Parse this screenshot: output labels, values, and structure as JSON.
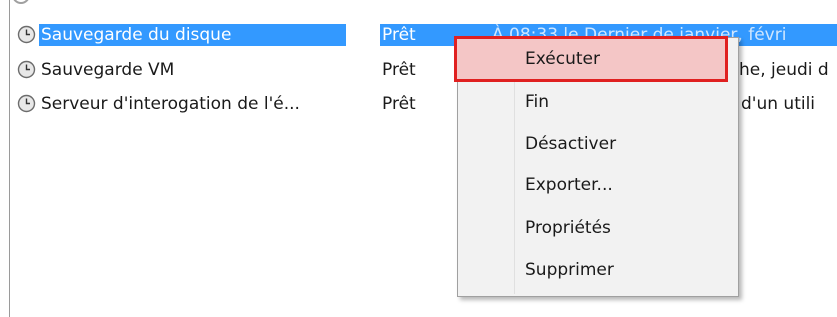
{
  "tasks": [
    {
      "name": "Sauvegarde du disque",
      "status": "Prêt",
      "trigger": "À 08:33 le Dernier de janvier, févri",
      "selected": true
    },
    {
      "name": "Sauvegarde VM",
      "status": "Prêt",
      "trigger": "he, jeudi d"
    },
    {
      "name": "Serveur d'interogation de l'é...",
      "status": "Prêt",
      "trigger": "d'un utili"
    }
  ],
  "context_menu": {
    "items": [
      "Exécuter",
      "Fin",
      "Désactiver",
      "Exporter...",
      "Propriétés",
      "Supprimer"
    ],
    "highlighted": "Exécuter"
  },
  "colors": {
    "selection": "#3399ff",
    "highlight_border": "#e02020",
    "highlight_fill": "#f4c6c6"
  },
  "icons": {
    "task": "clock-icon"
  }
}
